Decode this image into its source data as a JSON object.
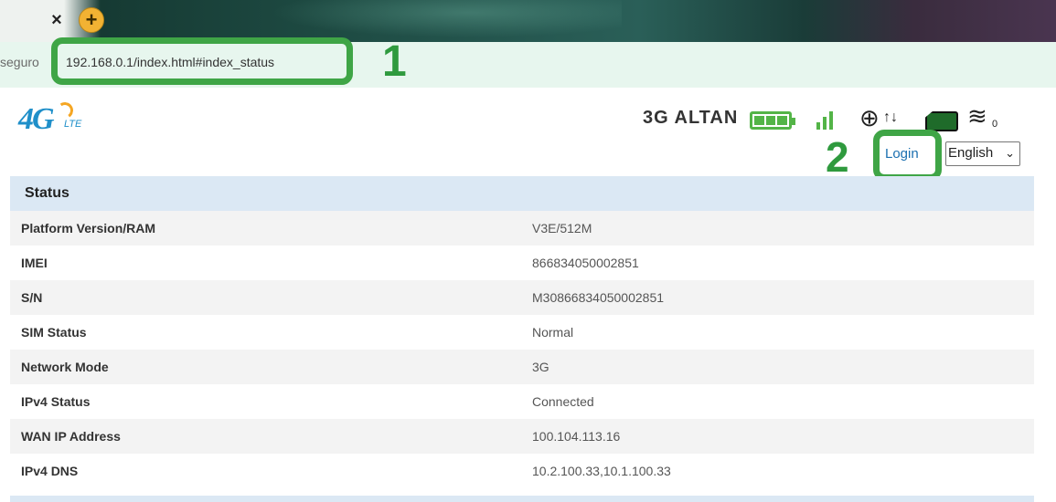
{
  "browser": {
    "tab_close_glyph": "×",
    "new_tab_glyph": "+",
    "address_prefix": "seguro",
    "url": "192.168.0.1/index.html#index_status",
    "annotation_1": "1",
    "annotation_2": "2",
    "accent_green": "#3fa546"
  },
  "header": {
    "logo_text": "4G",
    "logo_sub": "LTE",
    "network_label": "3G ALTAN",
    "icons": [
      "battery-icon",
      "signal-icon",
      "globe-icon",
      "data-arrows-icon",
      "sim-icon",
      "wifi-icon"
    ],
    "wifi_clients": "0",
    "login_label": "Login",
    "language_selected": "English"
  },
  "status": {
    "title": "Status",
    "rows": [
      {
        "label": "Platform Version/RAM",
        "value": "V3E/512M"
      },
      {
        "label": "IMEI",
        "value": "866834050002851"
      },
      {
        "label": "S/N",
        "value": "M30866834050002851"
      },
      {
        "label": "SIM Status",
        "value": "Normal"
      },
      {
        "label": "Network Mode",
        "value": "3G"
      },
      {
        "label": "IPv4 Status",
        "value": "Connected"
      },
      {
        "label": "WAN IP Address",
        "value": "100.104.113.16"
      },
      {
        "label": "IPv4 DNS",
        "value": "10.2.100.33,10.1.100.33"
      }
    ]
  }
}
